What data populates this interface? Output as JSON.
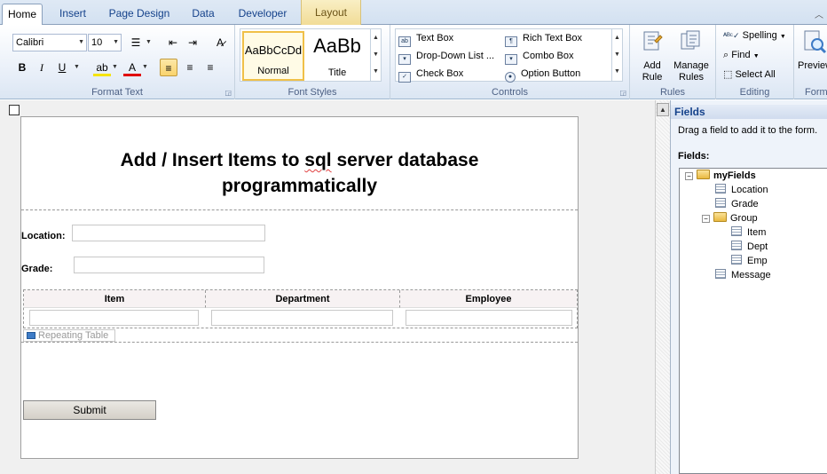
{
  "tabs": [
    {
      "label": "Home",
      "active": true
    },
    {
      "label": "Insert"
    },
    {
      "label": "Page Design"
    },
    {
      "label": "Data"
    },
    {
      "label": "Developer"
    },
    {
      "label": "Layout",
      "contextual": true
    }
  ],
  "ribbon": {
    "format_text": {
      "label": "Format Text",
      "font_name": "Calibri",
      "font_size": "10"
    },
    "font_styles": {
      "label": "Font Styles",
      "items": [
        {
          "sample": "AaBbCcDd",
          "name": "Normal",
          "selected": true
        },
        {
          "sample": "AaBb",
          "name": "Title"
        }
      ]
    },
    "controls": {
      "label": "Controls",
      "items": [
        {
          "label": "Text Box",
          "icon": "text-box-icon"
        },
        {
          "label": "Rich Text Box",
          "icon": "rich-text-box-icon"
        },
        {
          "label": "Drop-Down List ...",
          "icon": "drop-down-list-icon"
        },
        {
          "label": "Combo Box",
          "icon": "combo-box-icon"
        },
        {
          "label": "Check Box",
          "icon": "check-box-icon"
        },
        {
          "label": "Option Button",
          "icon": "option-button-icon"
        }
      ]
    },
    "rules": {
      "label": "Rules",
      "add_rule": "Add Rule",
      "manage_rules": "Manage Rules"
    },
    "editing": {
      "label": "Editing",
      "spelling": "Spelling",
      "find": "Find",
      "select_all": "Select All"
    },
    "form": {
      "label": "Form",
      "preview": "Preview"
    }
  },
  "form": {
    "title_line1_a": "Add / Insert Items to ",
    "title_line1_b": "sql",
    "title_line1_c": " server database",
    "title_line2": "programmatically",
    "location_label": "Location:",
    "grade_label": "Grade:",
    "table_headers": [
      "Item",
      "Department",
      "Employee"
    ],
    "repeating_table_tag": "Repeating Table",
    "submit_label": "Submit"
  },
  "fields_pane": {
    "title": "Fields",
    "hint": "Drag a field to add it to the form.",
    "fields_label": "Fields:",
    "tree": {
      "root": "myFields",
      "location": "Location",
      "grade": "Grade",
      "group": "Group",
      "item": "Item",
      "dept": "Dept",
      "emp": "Emp",
      "message": "Message"
    }
  }
}
